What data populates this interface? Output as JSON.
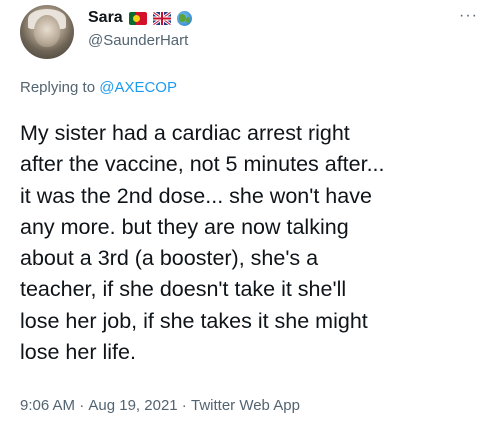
{
  "author": {
    "display_name": "Sara",
    "handle": "@SaunderHart",
    "badges": [
      "flag-portugal-icon",
      "flag-uk-icon",
      "globe-icon"
    ]
  },
  "more_menu": "···",
  "reply": {
    "prefix": "Replying to ",
    "mention": "@AXECOP"
  },
  "tweet": {
    "text": "My sister had a cardiac arrest right\nafter the vaccine, not 5 minutes after...\nit was the 2nd dose... she won't have\nany more. but they are now talking\nabout a 3rd (a booster), she's a\nteacher, if she doesn't take it she'll\nlose her job, if she takes it she might\nlose her life."
  },
  "meta": {
    "time": "9:06 AM",
    "separator": " · ",
    "date": "Aug 19, 2021",
    "source": "Twitter Web App"
  },
  "colors": {
    "text": "#0f1419",
    "secondary": "#536471",
    "link": "#1d9bf0"
  }
}
